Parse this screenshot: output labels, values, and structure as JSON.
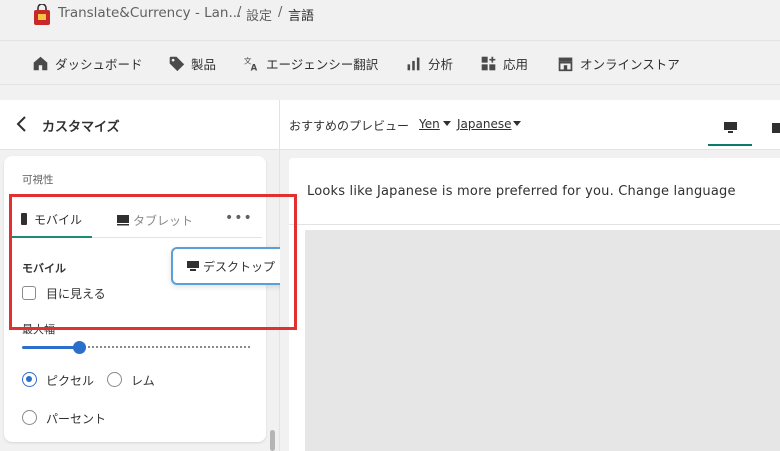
{
  "breadcrumb": {
    "app_name": "Translate&Currency - Lan...",
    "separator": "/",
    "settings": "設定",
    "current": "言語"
  },
  "nav": {
    "items": [
      {
        "label": "ダッシュボード",
        "icon": "home-icon"
      },
      {
        "label": "製品",
        "icon": "tag-icon"
      },
      {
        "label": "エージェンシー翻訳",
        "icon": "translate-icon"
      },
      {
        "label": "分析",
        "icon": "bar-chart-icon"
      },
      {
        "label": "応用",
        "icon": "apps-icon"
      },
      {
        "label": "オンラインストア",
        "icon": "store-icon"
      }
    ]
  },
  "editor": {
    "title": "カスタマイズ",
    "preview_label": "おすすめのプレビュー",
    "currency": "Yen",
    "language": "Japanese"
  },
  "visibility": {
    "label": "可視性",
    "tabs": [
      {
        "label": "モバイル",
        "icon": "mobile-icon",
        "active": true
      },
      {
        "label": "タブレット",
        "icon": "tablet-icon",
        "active": false
      }
    ],
    "more_label": "•••",
    "overflow_item": "デスクトップ",
    "section_title": "モバイル",
    "checkbox_label": "目に見える",
    "checkbox_checked": false,
    "max_width_label": "最大幅",
    "max_width_value_fraction": 0.25,
    "units": [
      {
        "label": "ピクセル",
        "checked": true
      },
      {
        "label": "レム",
        "checked": false
      },
      {
        "label": "パーセント",
        "checked": false
      }
    ]
  },
  "preview": {
    "banner_text": "Looks like Japanese is more preferred for you. Change language"
  },
  "colors": {
    "accent": "#2c6ecb",
    "tab_underline": "#1f8a77",
    "highlight": "#e03030"
  }
}
